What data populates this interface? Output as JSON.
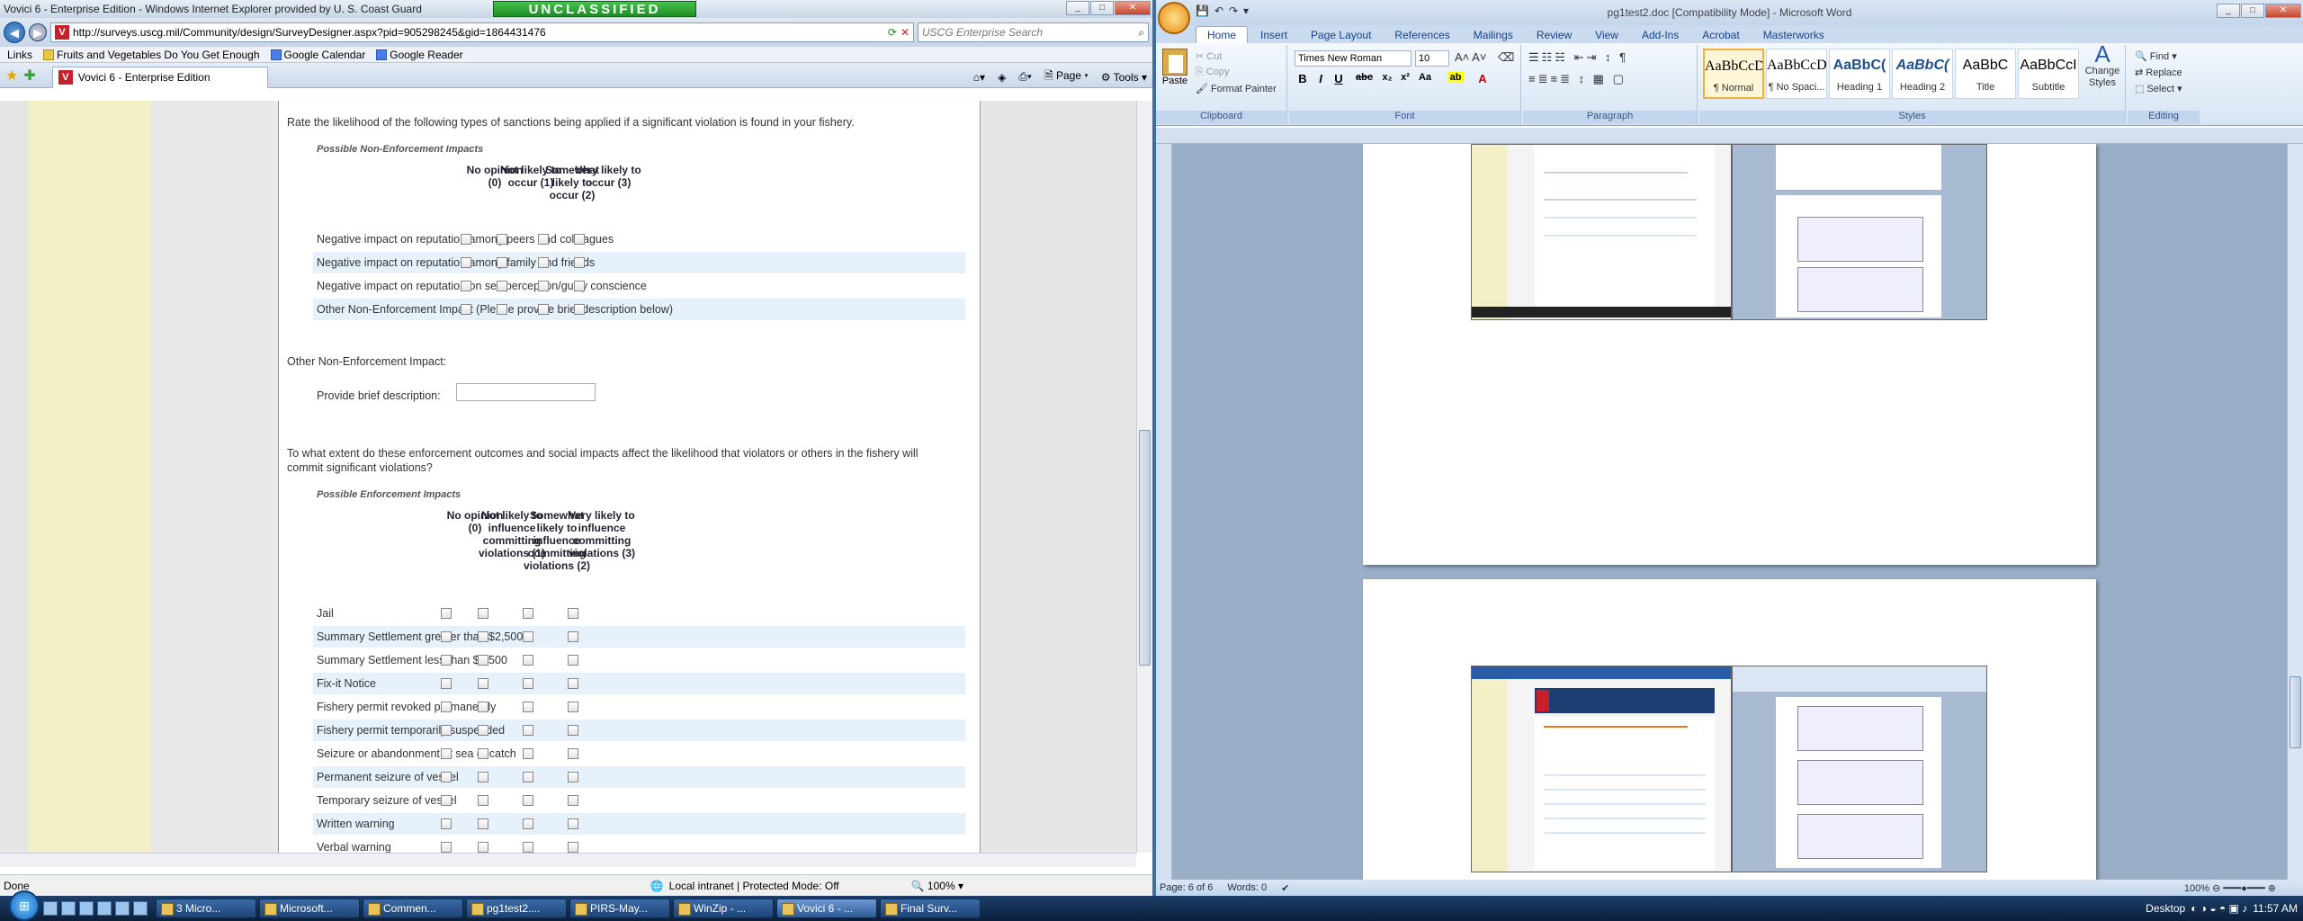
{
  "ie": {
    "title": "Vovici 6 - Enterprise Edition - Windows Internet Explorer provided by U. S. Coast Guard",
    "classification": "UNCLASSIFIED",
    "url": "http://surveys.uscg.mil/Community/design/SurveyDesigner.aspx?pid=905298245&gid=1864431476",
    "search_placeholder": "USCG Enterprise Search",
    "links_label": "Links",
    "links": [
      "Fruits and Vegetables Do You Get Enough",
      "Google Calendar",
      "Google Reader"
    ],
    "tab_title": "Vovici 6 - Enterprise Edition",
    "cmd_page": "Page",
    "cmd_tools": "Tools",
    "status_done": "Done",
    "status_zone": "Local intranet | Protected Mode: Off",
    "zoom": "100%"
  },
  "survey": {
    "q1_text": "Rate the likelihood of the following types of sanctions being applied if a significant violation is found in your fishery.",
    "q1_section": "Possible Non-Enforcement Impacts",
    "q1_headers": [
      "No opinion (0)",
      "Not likely to occur (1)",
      "Somewhat likely to occur (2)",
      "Very likely to occur (3)"
    ],
    "q1_rows": [
      "Negative impact on reputation among peers and colleagues",
      "Negative impact on reputation among family and friends",
      "Negative impact on reputation on self perception/guilty conscience",
      "Other Non-Enforcement Impact (Please provide brief description below)"
    ],
    "other_title": "Other Non-Enforcement Impact:",
    "other_label": "Provide brief description:",
    "q2_text_1": "To what extent do these enforcement outcomes and social impacts affect the likelihood that violators or others in the fishery will",
    "q2_text_2": "commit significant violations?",
    "q2_section": "Possible Enforcement Impacts",
    "q2_headers": [
      "No opinion (0)",
      "Not likely to influence committing violations (1)",
      "Somewhat likely to influence committing violations (2)",
      "Very likely to influence committing violations (3)"
    ],
    "q2_rows": [
      "Jail",
      "Summary Settlement greater than $2,500",
      "Summary Settlement less than $2,500",
      "Fix-it Notice",
      "Fishery permit revoked permanently",
      "Fishery permit temporarily suspended",
      "Seizure or abandonment at sea of catch",
      "Permanent seizure of vessel",
      "Temporary seizure of vessel",
      "Written warning",
      "Verbal warning"
    ]
  },
  "word": {
    "title": "pg1test2.doc [Compatibility Mode] - Microsoft Word",
    "tabs": [
      "Home",
      "Insert",
      "Page Layout",
      "References",
      "Mailings",
      "Review",
      "View",
      "Add-Ins",
      "Acrobat",
      "Masterworks"
    ],
    "clipboard": {
      "paste": "Paste",
      "cut": "Cut",
      "copy": "Copy",
      "format_painter": "Format Painter",
      "label": "Clipboard"
    },
    "font": {
      "name": "Times New Roman",
      "size": "10",
      "label": "Font"
    },
    "paragraph_label": "Paragraph",
    "styles": [
      {
        "preview": "AaBbCcDc",
        "name": "¶ Normal"
      },
      {
        "preview": "AaBbCcDc",
        "name": "¶ No Spaci..."
      },
      {
        "preview": "AaBbC(",
        "name": "Heading 1"
      },
      {
        "preview": "AaBbC(",
        "name": "Heading 2"
      },
      {
        "preview": "AaBbC",
        "name": "Title"
      },
      {
        "preview": "AaBbCcI",
        "name": "Subtitle"
      }
    ],
    "change_styles": "Change Styles",
    "styles_label": "Styles",
    "editing": {
      "find": "Find",
      "replace": "Replace",
      "select": "Select",
      "label": "Editing"
    },
    "status_page": "Page: 6 of 6",
    "status_words": "Words: 0",
    "zoom": "100%"
  },
  "taskbar": {
    "items": [
      "3 Micro...",
      "Microsoft...",
      "Commen...",
      "pg1test2....",
      "PIRS-May...",
      "WinZip - ...",
      "Vovici 6 - ...",
      "Final Surv..."
    ],
    "desktop": "Desktop",
    "clock": "11:57 AM"
  }
}
